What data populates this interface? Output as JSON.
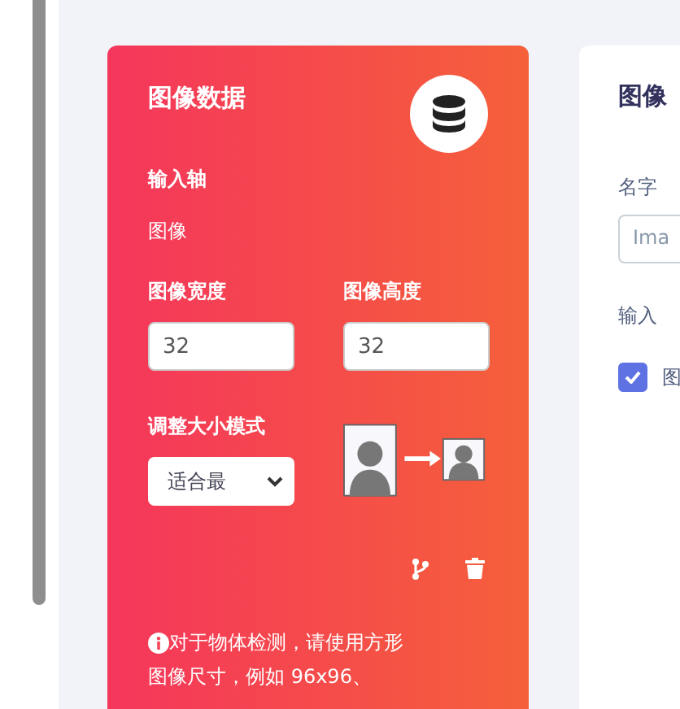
{
  "block": {
    "title": "图像数据",
    "input_axes_label": "输入轴",
    "input_axes_value": "图像",
    "width": {
      "label": "图像宽度",
      "value": "32"
    },
    "height": {
      "label": "图像高度",
      "value": "32"
    },
    "resize_mode": {
      "label": "调整大小模式",
      "value": "适合最"
    },
    "note_lines": [
      "对于物体检测，请使用方形",
      "图像尺寸，例如 96x96、"
    ]
  },
  "panel": {
    "title": "图像",
    "name_label": "名字",
    "name_value": "Ima",
    "axes_label": "输入",
    "axes": [
      {
        "label": "图",
        "checked": true
      }
    ]
  }
}
